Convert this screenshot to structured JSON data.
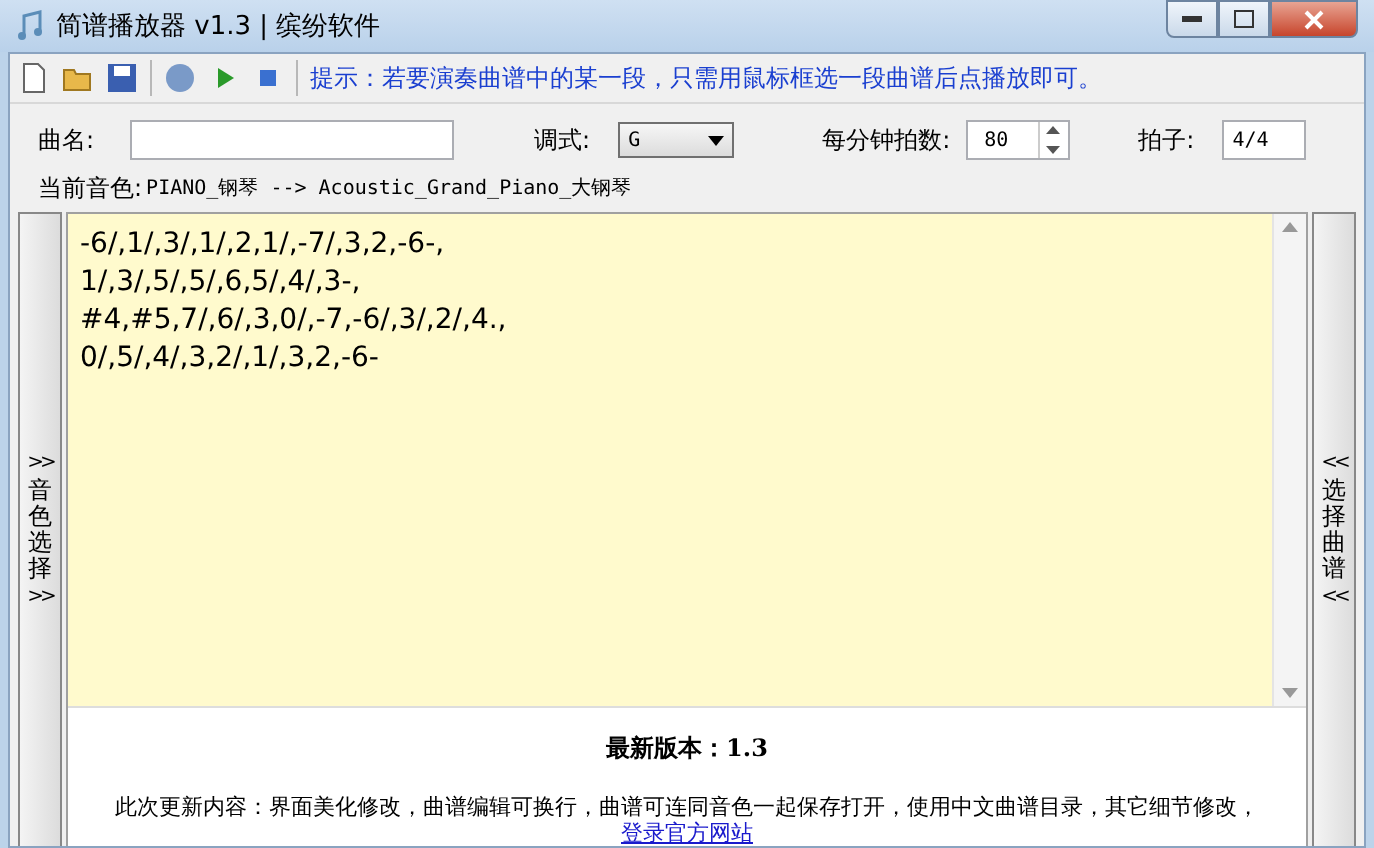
{
  "window": {
    "title": "简谱播放器 v1.3 | 缤纷软件"
  },
  "toolbar": {
    "tip": "提示：若要演奏曲谱中的某一段，只需用鼠标框选一段曲谱后点播放即可。"
  },
  "form": {
    "name_label": "曲名:",
    "key_label": "调式:",
    "key_value": "G",
    "bpm_label": "每分钟拍数:",
    "bpm_value": "80",
    "meter_label": "拍子:",
    "meter_value": "4/4"
  },
  "instrument": {
    "label": "当前音色:",
    "value": "PIANO_钢琴 --> Acoustic_Grand_Piano_大钢琴"
  },
  "left_tab": {
    "arrows_top": ">>",
    "label": "音色选择",
    "arrows_bottom": ">>"
  },
  "right_tab": {
    "arrows_top": "<<",
    "label": "选择曲谱",
    "arrows_bottom": "<<"
  },
  "score": {
    "lines": [
      "-6/,1/,3/,1/,2,1/,-7/,3,2,-6-,",
      "1/,3/,5/,5/,6,5/,4/,3-,",
      "#4,#5,7/,6/,3,0/,-7,-6/,3/,2/,4.,",
      "0/,5/,4/,3,2/,1/,3,2,-6-"
    ]
  },
  "info": {
    "heading": "最新版本：1.3",
    "text": "此次更新内容：界面美化修改，曲谱编辑可换行，曲谱可连同音色一起保存打开，使用中文曲谱目录，其它细节修改，",
    "link": "登录官方网站"
  }
}
